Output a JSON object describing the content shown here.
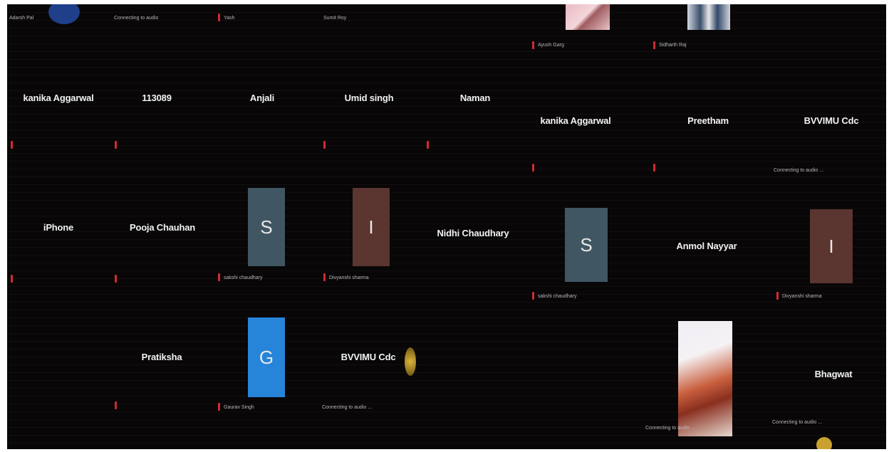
{
  "top_row": {
    "captions": [
      "Adarsh Pal",
      "Connecting to audio",
      "Yash",
      "Sumit Roy",
      "Ayush Garg",
      "Sidharth Raj"
    ]
  },
  "row1": {
    "names": [
      "kanika Aggarwal",
      "113089",
      "Anjali",
      "Umid singh",
      "Naman",
      "kanika Aggarwal",
      "Preetham",
      "BVVIMU Cdc"
    ],
    "connecting": "Connecting to audio ..."
  },
  "row2": {
    "names": [
      "iPhone",
      "Pooja Chauhan",
      "Nidhi Chaudhary",
      "Anmol Nayyar"
    ],
    "avatars": [
      "S",
      "I",
      "S",
      "I"
    ],
    "captions": [
      "sakshi chaudhary",
      "Divyanshi sharma",
      "sakshi chaudhary",
      "Divyanshi sharma"
    ]
  },
  "row3": {
    "names": [
      "Pratiksha",
      "BVVIMU Cdc",
      "Bhagwat"
    ],
    "avatar": "G",
    "captions": [
      "Gaurav Singh",
      "Connecting to audio ...",
      "Connecting to audio ...",
      "Connecting to audio ..."
    ]
  },
  "colors": {
    "background": "#080606",
    "avatar_slate": "#415663",
    "avatar_brown": "#5b3530",
    "avatar_blue": "#2684d9",
    "mic_muted": "#d22a32"
  }
}
